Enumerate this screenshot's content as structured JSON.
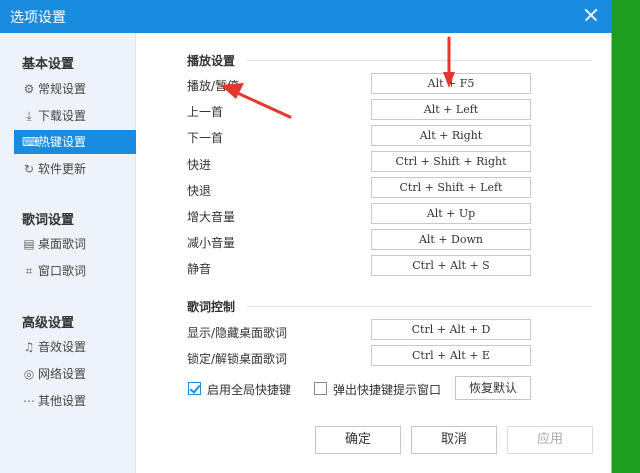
{
  "window": {
    "title": "选项设置"
  },
  "sidebar": {
    "sections": [
      {
        "title": "基本设置",
        "items": [
          {
            "label": "常规设置",
            "icon": "gear-icon",
            "glyph": "⚙",
            "active": false
          },
          {
            "label": "下载设置",
            "icon": "download-icon",
            "glyph": "⤓",
            "active": false
          },
          {
            "label": "热键设置",
            "icon": "keyboard-icon",
            "glyph": "⌨",
            "active": true
          },
          {
            "label": "软件更新",
            "icon": "update-icon",
            "glyph": "↻",
            "active": false
          }
        ]
      },
      {
        "title": "歌词设置",
        "items": [
          {
            "label": "桌面歌词",
            "icon": "lyrics-icon",
            "glyph": "▤",
            "active": false
          },
          {
            "label": "窗口歌词",
            "icon": "window-lyrics-icon",
            "glyph": "⌗",
            "active": false
          }
        ]
      },
      {
        "title": "高级设置",
        "items": [
          {
            "label": "音效设置",
            "icon": "equalizer-icon",
            "glyph": "♫",
            "active": false
          },
          {
            "label": "网络设置",
            "icon": "network-icon",
            "glyph": "◎",
            "active": false
          },
          {
            "label": "其他设置",
            "icon": "more-icon",
            "glyph": "⋯",
            "active": false
          }
        ]
      }
    ]
  },
  "playback": {
    "title": "播放设置",
    "rows": [
      {
        "label": "播放/暂停",
        "hotkey": "Alt + F5"
      },
      {
        "label": "上一首",
        "hotkey": "Alt + Left"
      },
      {
        "label": "下一首",
        "hotkey": "Alt + Right"
      },
      {
        "label": "快进",
        "hotkey": "Ctrl + Shift + Right"
      },
      {
        "label": "快退",
        "hotkey": "Ctrl + Shift + Left"
      },
      {
        "label": "增大音量",
        "hotkey": "Alt + Up"
      },
      {
        "label": "减小音量",
        "hotkey": "Alt + Down"
      },
      {
        "label": "静音",
        "hotkey": "Ctrl + Alt + S"
      }
    ]
  },
  "lyrics_control": {
    "title": "歌词控制",
    "rows": [
      {
        "label": "显示/隐藏桌面歌词",
        "hotkey": "Ctrl + Alt + D"
      },
      {
        "label": "锁定/解锁桌面歌词",
        "hotkey": "Ctrl + Alt + E"
      }
    ]
  },
  "options": {
    "global_hotkeys": {
      "label": "启用全局快捷键",
      "checked": true
    },
    "popup_hint": {
      "label": "弹出快捷键提示窗口",
      "checked": false
    },
    "restore_label": "恢复默认"
  },
  "footer": {
    "ok_label": "确定",
    "cancel_label": "取消",
    "apply_label": "应用"
  },
  "colors": {
    "accent": "#1a8ce0",
    "annotation_arrow": "#e8352d",
    "background": "#1e9e1e"
  }
}
